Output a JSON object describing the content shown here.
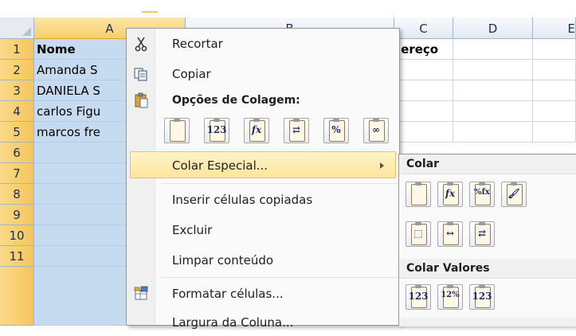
{
  "sheet": {
    "columns": [
      "A",
      "B",
      "C",
      "D",
      "E"
    ],
    "rows": [
      "1",
      "2",
      "3",
      "4",
      "5",
      "6",
      "7",
      "8",
      "9",
      "10",
      "11"
    ],
    "col_a": [
      "Nome",
      "Amanda S",
      "DANIELA S",
      "carlos Figu",
      "marcos fre"
    ],
    "col_c": [
      "lereço"
    ]
  },
  "context_menu": {
    "cut": "Recortar",
    "copy": "Copiar",
    "paste_options_header": "Opções de Colagem:",
    "paste_options": [
      {
        "icon": "paste-icon",
        "glyph": ""
      },
      {
        "icon": "paste-values-icon",
        "glyph": "123"
      },
      {
        "icon": "paste-formulas-icon",
        "glyph": "fx"
      },
      {
        "icon": "paste-transpose-icon",
        "glyph": "⇄"
      },
      {
        "icon": "paste-formatting-icon",
        "glyph": "%"
      },
      {
        "icon": "paste-link-icon",
        "glyph": "∞"
      }
    ],
    "paste_special": "Colar Especial...",
    "insert_copied": "Inserir células copiadas",
    "delete": "Excluir",
    "clear_contents": "Limpar conteúdo",
    "format_cells": "Formatar células...",
    "column_width": "Largura da Coluna..."
  },
  "submenu": {
    "paste_header": "Colar",
    "paste_row1": [
      {
        "icon": "paste-icon",
        "glyph": ""
      },
      {
        "icon": "paste-formulas-icon",
        "glyph": "fx"
      },
      {
        "icon": "paste-formulas-number-formatting-icon",
        "glyph": "%fx"
      },
      {
        "icon": "paste-keep-source-formatting-icon",
        "glyph": "🖌"
      }
    ],
    "paste_row2": [
      {
        "icon": "paste-no-borders-icon",
        "glyph": "⬚"
      },
      {
        "icon": "paste-keep-column-widths-icon",
        "glyph": "↔"
      },
      {
        "icon": "paste-transpose-icon",
        "glyph": "⇄"
      }
    ],
    "values_header": "Colar Valores",
    "values_row": [
      {
        "icon": "paste-values-icon",
        "glyph": "123"
      },
      {
        "icon": "paste-values-number-formatting-icon",
        "glyph": "12%"
      },
      {
        "icon": "paste-values-source-formatting-icon",
        "glyph": "123"
      }
    ]
  },
  "colors": {
    "selection": "#c6dbf0",
    "header_selected": "#f6cf6a",
    "menu_highlight": "#fde59b"
  }
}
